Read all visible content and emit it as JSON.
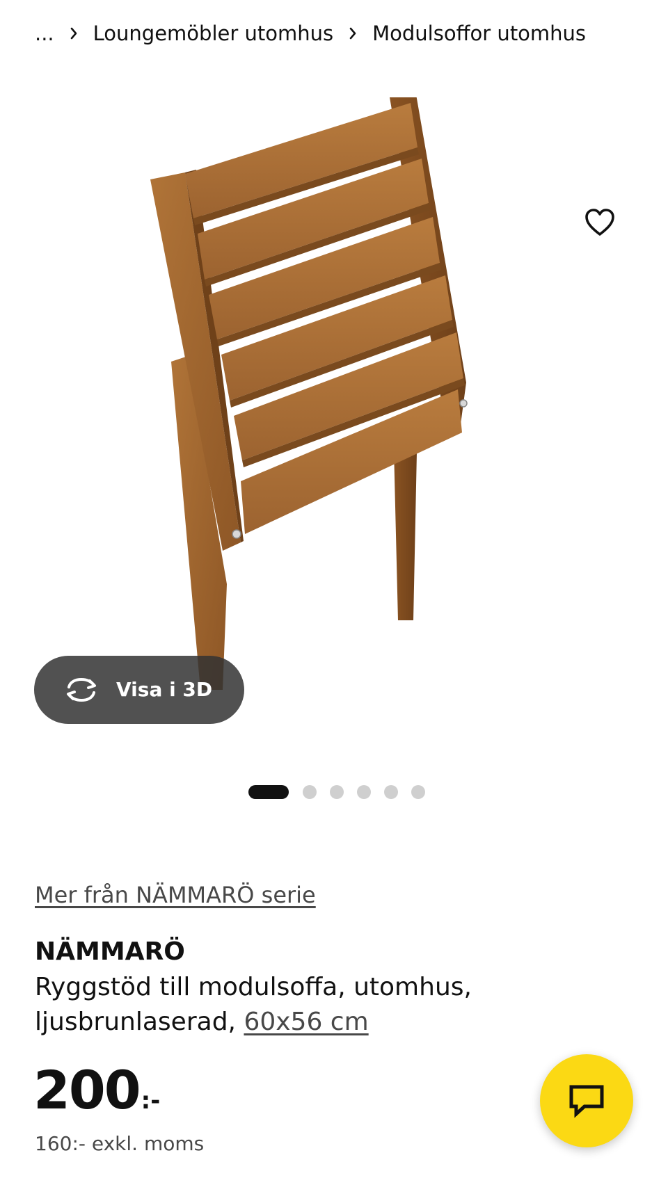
{
  "breadcrumb": {
    "ellipsis": "...",
    "items": [
      {
        "label": "Loungemöbler utomhus"
      },
      {
        "label": "Modulsoffor utomhus"
      }
    ]
  },
  "gallery": {
    "view3d_label": "Visa i 3D",
    "dot_count": 6,
    "active_index": 0,
    "accent_color": "#111111"
  },
  "product": {
    "series_link": "Mer från NÄMMARÖ serie",
    "name": "NÄMMARÖ",
    "description": "Ryggstöd till modulsoffa, utomhus, ljusbrunlaserad,",
    "size_link": "60x56 cm",
    "price_amount": "200",
    "price_suffix": ":-",
    "price_excl_vat": "160:- exkl. moms"
  },
  "icons": {
    "favourite": "heart-icon",
    "view3d": "rotate-3d-icon",
    "chat": "chat-bubble-icon",
    "breadcrumb_separator": "chevron-right-icon"
  },
  "colors": {
    "chat_button": "#fbd914",
    "view3d_background": "#323232",
    "inactive_dot": "#cfcfcf"
  }
}
